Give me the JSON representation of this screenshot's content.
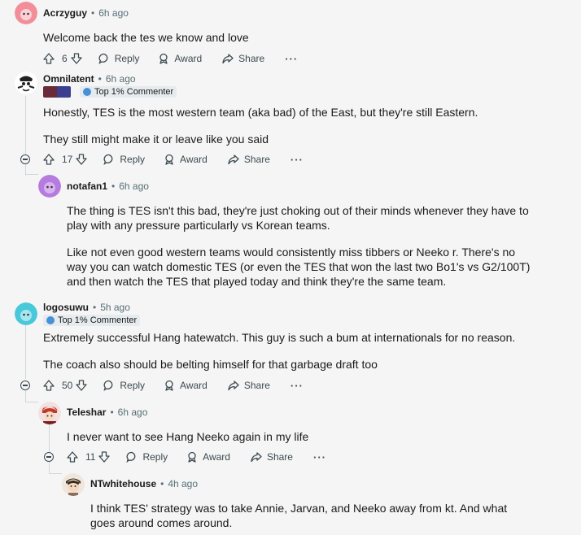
{
  "labels": {
    "reply": "Reply",
    "award": "Award",
    "share": "Share",
    "more": "···"
  },
  "colors": {
    "background": "#f5f5f5",
    "thread_line": "#d0d7da",
    "badge_bg": "#e5ebee",
    "muted": "#576f76"
  },
  "comments": [
    {
      "username": "Acrzyguy",
      "time": "6h ago",
      "avatar_color": "#f28e9a",
      "paragraphs": [
        "Welcome back the tes we know and love"
      ],
      "votes": "6"
    },
    {
      "username": "Omnilatent",
      "time": "6h ago",
      "avatar_color": "#ffffff",
      "badge": "Top 1% Commenter",
      "paragraphs": [
        "Honestly, TES is the most western team (aka bad) of the East, but they're still Eastern.",
        "They still might make it or leave like you said"
      ],
      "votes": "17"
    },
    {
      "username": "notafan1",
      "time": "6h ago",
      "avatar_color": "#b57bdf",
      "paragraphs": [
        "The thing is TES isn't this bad, they're just choking out of their minds whenever they have to play with any pressure particularly vs Korean teams.",
        "Like not even good western teams would consistently miss tibbers or Neeko r. There's no way you can watch domestic TES (or even the TES that won the last two Bo1's vs G2/100T) and then watch the TES that played today and think they're the same team."
      ]
    },
    {
      "username": "logosuwu",
      "time": "5h ago",
      "avatar_color": "#48c8d8",
      "badge": "Top 1% Commenter",
      "paragraphs": [
        "Extremely successful Hang hatewatch. This guy is such a bum at internationals for no reason.",
        "The coach also should be belting himself for that garbage draft too"
      ],
      "votes": "50"
    },
    {
      "username": "Teleshar",
      "time": "6h ago",
      "avatar_color": "#c0392b",
      "paragraphs": [
        "I never want to see Hang Neeko again in my life"
      ],
      "votes": "11"
    },
    {
      "username": "NTwhitehouse",
      "time": "4h ago",
      "avatar_color": "#8a6d5a",
      "paragraphs": [
        "I think TES' strategy was to take Annie, Jarvan, and Neeko away from kt. And what goes around comes around."
      ]
    }
  ]
}
